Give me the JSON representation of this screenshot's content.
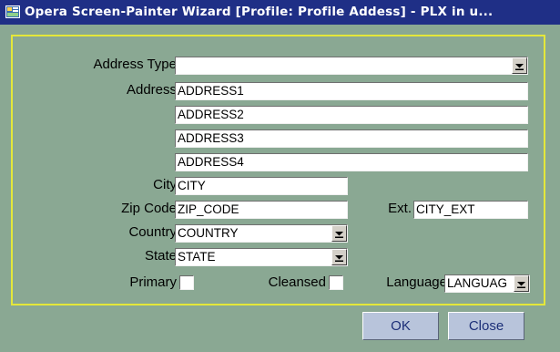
{
  "window": {
    "title": "Opera Screen-Painter Wizard [Profile: Profile Addess]  - PLX in u..."
  },
  "form": {
    "address_type_label": "Address Type",
    "address_type_value": "",
    "address_label": "Address",
    "address1": "ADDRESS1",
    "address2": "ADDRESS2",
    "address3": "ADDRESS3",
    "address4": "ADDRESS4",
    "city_label": "City",
    "city_value": "CITY",
    "zip_label": "Zip Code",
    "zip_value": "ZIP_CODE",
    "ext_label": "Ext.",
    "ext_value": "CITY_EXT",
    "country_label": "Country",
    "country_value": "COUNTRY",
    "state_label": "State",
    "state_value": "STATE",
    "primary_label": "Primary",
    "cleansed_label": "Cleansed",
    "language_label": "Language",
    "language_value": "LANGUAG"
  },
  "buttons": {
    "ok": "OK",
    "close": "Close"
  }
}
